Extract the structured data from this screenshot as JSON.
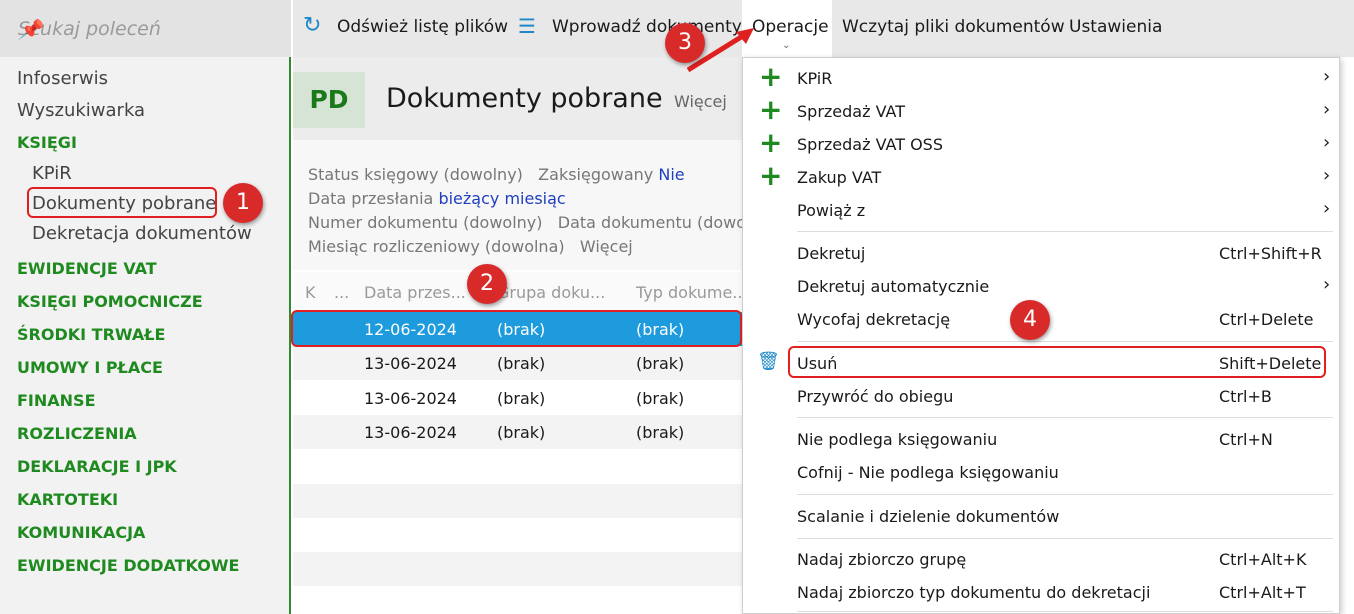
{
  "sidebar": {
    "search_placeholder": "Szukaj poleceń",
    "items": [
      "Infoserwis",
      "Wyszukiwarka"
    ],
    "sections": [
      "KSIĘGI",
      "EWIDENCJE VAT",
      "KSIĘGI POMOCNICZE",
      "ŚRODKI TRWAŁE",
      "UMOWY I PŁACE",
      "FINANSE",
      "ROZLICZENIA",
      "DEKLARACJE I JPK",
      "KARTOTEKI",
      "KOMUNIKACJA",
      "EWIDENCJE DODATKOWE"
    ],
    "sub": [
      "KPiR",
      "Dokumenty pobrane",
      "Dekretacja dokumentów"
    ]
  },
  "toolbar": {
    "refresh": "Odśwież listę plików",
    "enter": "Wprowadź dokumenty",
    "operations": "Operacje",
    "load": "Wczytaj pliki dokumentów",
    "settings": "Ustawienia"
  },
  "header": {
    "badge": "PD",
    "title": "Dokumenty pobrane",
    "more": "Więcej"
  },
  "filters": {
    "status": "Status księgowy (dowolny)",
    "posted_label": "Zaksięgowany",
    "posted_value": "Nie",
    "date_label": "Data przesłania",
    "date_value": "bieżący miesiąc",
    "number": "Numer dokumentu (dowolny)",
    "doc_date": "Data dokumentu (dowolna)",
    "month": "Miesiąc rozliczeniowy (dowolna)",
    "more": "Więcej"
  },
  "table": {
    "columns": [
      "K",
      "...",
      "Data przes...",
      "Grupa doku...",
      "Typ dokume..."
    ],
    "rows": [
      [
        "12-06-2024",
        "(brak)",
        "(brak)"
      ],
      [
        "13-06-2024",
        "(brak)",
        "(brak)"
      ],
      [
        "13-06-2024",
        "(brak)",
        "(brak)"
      ],
      [
        "13-06-2024",
        "(brak)",
        "(brak)"
      ]
    ]
  },
  "menu": [
    {
      "label": "KPiR",
      "shortcut": ""
    },
    {
      "label": "Sprzedaż VAT",
      "shortcut": ""
    },
    {
      "label": "Sprzedaż VAT OSS",
      "shortcut": ""
    },
    {
      "label": "Zakup VAT",
      "shortcut": ""
    },
    {
      "label": "Powiąż z",
      "shortcut": ""
    },
    {
      "label": "Dekretuj",
      "shortcut": "Ctrl+Shift+R"
    },
    {
      "label": "Dekretuj automatycznie",
      "shortcut": ""
    },
    {
      "label": "Wycofaj dekretację",
      "shortcut": "Ctrl+Delete"
    },
    {
      "label": "Usuń",
      "shortcut": "Shift+Delete"
    },
    {
      "label": "Przywróć do obiegu",
      "shortcut": "Ctrl+B"
    },
    {
      "label": "Nie podlega księgowaniu",
      "shortcut": "Ctrl+N"
    },
    {
      "label": "Cofnij - Nie podlega księgowaniu",
      "shortcut": ""
    },
    {
      "label": "Scalanie i dzielenie dokumentów",
      "shortcut": ""
    },
    {
      "label": "Nadaj zbiorczo grupę",
      "shortcut": "Ctrl+Alt+K"
    },
    {
      "label": "Nadaj zbiorczo typ dokumentu do dekretacji",
      "shortcut": "Ctrl+Alt+T"
    }
  ],
  "badges": [
    "1",
    "2",
    "3",
    "4"
  ]
}
